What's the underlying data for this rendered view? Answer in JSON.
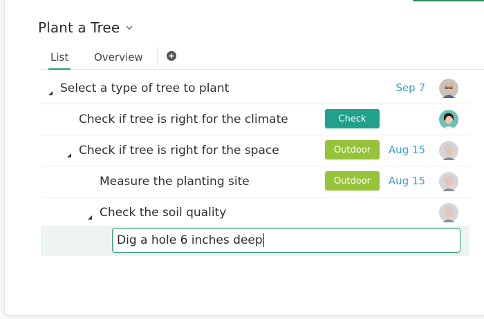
{
  "project": {
    "title": "Plant a Tree"
  },
  "tabs": {
    "list": "List",
    "overview": "Overview"
  },
  "rows": [
    {
      "text": "Select a type of tree to plant",
      "tag": "",
      "date": "Sep 7"
    },
    {
      "text": "Check if tree is right for the climate",
      "tag": "Check",
      "date": ""
    },
    {
      "text": "Check if tree is right for the space",
      "tag": "Outdoor",
      "date": "Aug 15"
    },
    {
      "text": "Measure the planting site",
      "tag": "Outdoor",
      "date": "Aug 15"
    },
    {
      "text": "Check the soil quality",
      "tag": "",
      "date": ""
    }
  ],
  "editing": {
    "value": "Dig a hole 6 inches deep"
  },
  "colors": {
    "accent": "#1f9e76",
    "check_tag": "#21a18a",
    "outdoor_tag": "#97c33b",
    "date": "#3a9bd0"
  }
}
